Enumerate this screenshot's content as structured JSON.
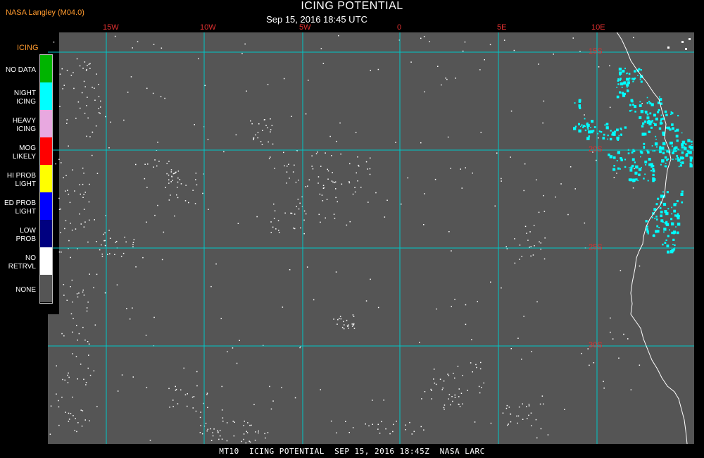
{
  "header": {
    "source": "NASA Langley (M04.0)",
    "title": "ICING POTENTIAL",
    "subtitle": "Sep 15, 2016 18:45 UTC"
  },
  "legend": {
    "title": "ICING",
    "items": [
      {
        "label": "NO DATA",
        "color": "#00b400"
      },
      {
        "label": "NIGHT ICING",
        "color": "#00ffff"
      },
      {
        "label": "HEAVY ICING",
        "color": "#e8a8e0"
      },
      {
        "label": "MOG LIKELY",
        "color": "#ff0000"
      },
      {
        "label": "HI PROB LIGHT",
        "color": "#ffff00"
      },
      {
        "label": "ED PROB LIGHT",
        "color": "#0000ff"
      },
      {
        "label": "LOW PROB",
        "color": "#000080"
      },
      {
        "label": "NO RETRVL",
        "color": "#ffffff"
      },
      {
        "label": "NONE",
        "color": "#555555"
      }
    ]
  },
  "grid": {
    "longitudes": [
      "15W",
      "10W",
      "5W",
      "0",
      "5E",
      "10E"
    ],
    "latitudes": [
      "15S",
      "20S",
      "25S",
      "30S"
    ],
    "line_color": "#00c8c8",
    "label_color": "#e03030"
  },
  "map_colors": {
    "background": "#555555",
    "coastline": "#ffffff",
    "night_icing": "#00ffff",
    "no_retrieval": "#ffffff"
  },
  "footer": {
    "text": "MT10  ICING POTENTIAL  SEP 15, 2016 18:45Z  NASA LARC"
  }
}
